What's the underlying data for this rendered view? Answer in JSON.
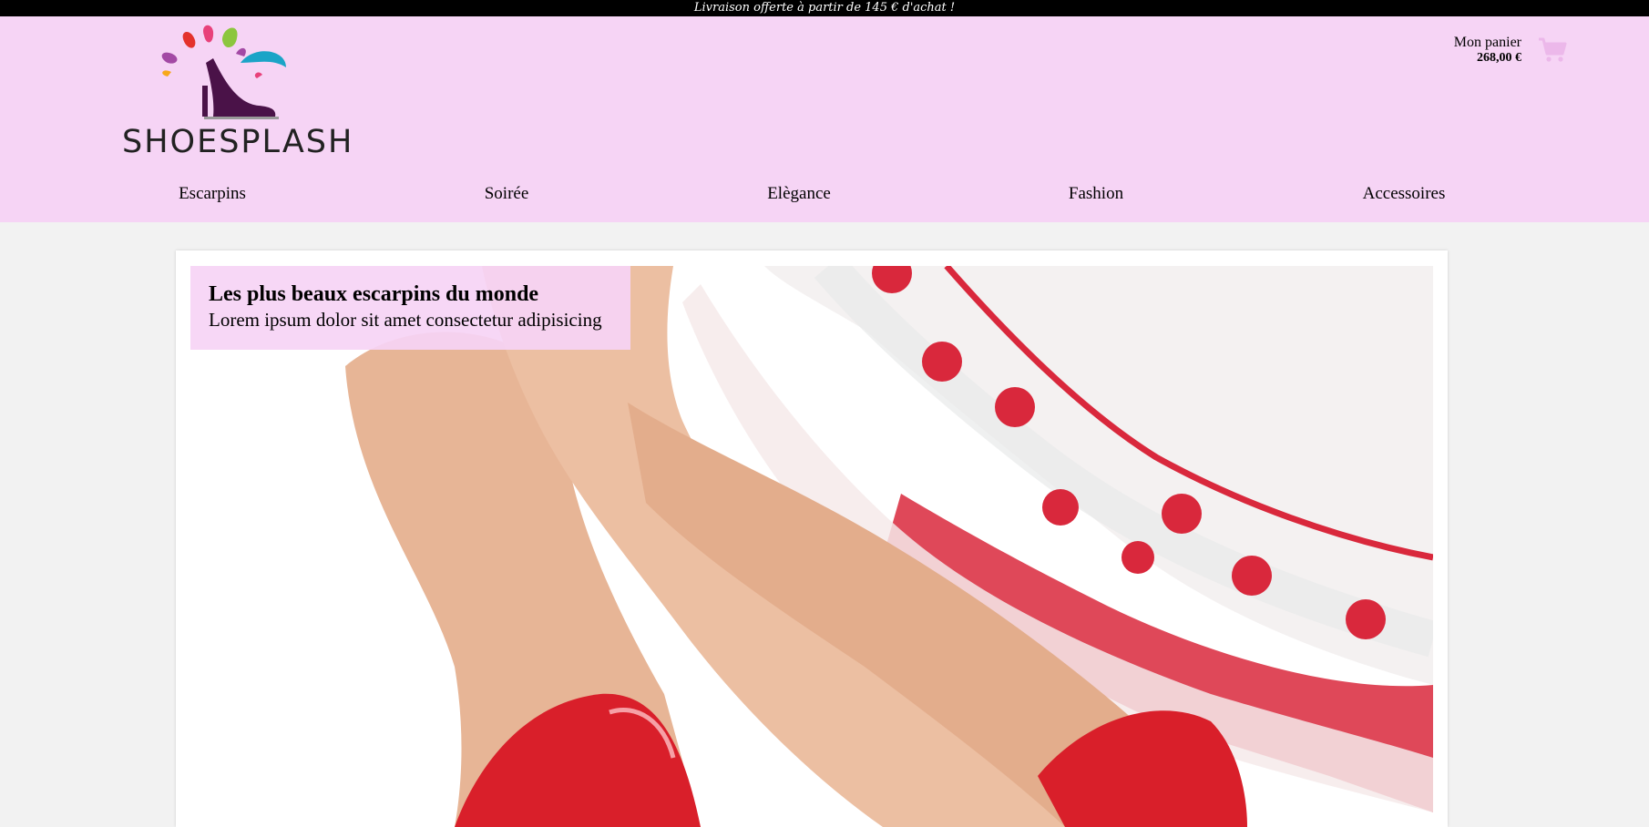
{
  "topbar": {
    "text": "Livraison offerte à partir de 145 € d'achat !"
  },
  "brand": {
    "name": "SHOESPLASH",
    "background": "#f6d4f5"
  },
  "cart": {
    "label": "Mon panier",
    "amount": "268,00 €",
    "icon": "cart-icon"
  },
  "nav": {
    "items": [
      {
        "label": "Escarpins"
      },
      {
        "label": "Soirée"
      },
      {
        "label": "Elègance"
      },
      {
        "label": "Fashion"
      },
      {
        "label": "Accessoires"
      }
    ]
  },
  "hero": {
    "title": "Les plus beaux escarpins du monde",
    "subtitle": "Lorem ipsum dolor sit amet consectetur adipisicing"
  }
}
